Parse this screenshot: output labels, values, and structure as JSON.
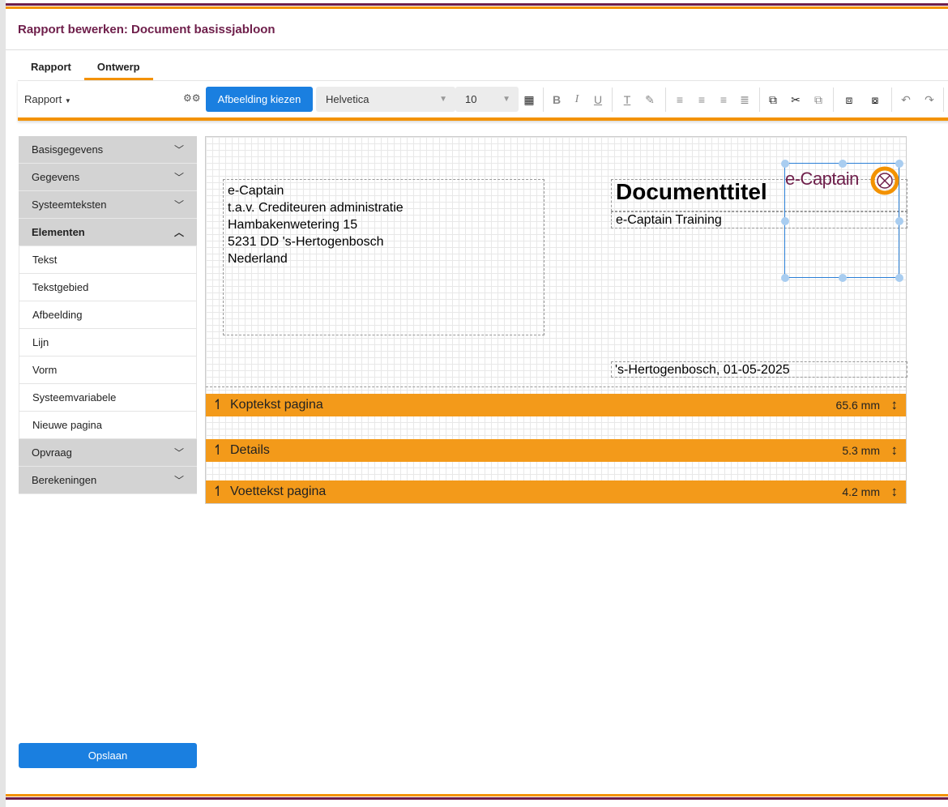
{
  "page": {
    "title": "Rapport bewerken: Document basissjabloon"
  },
  "tabs": [
    {
      "label": "Rapport",
      "active": false
    },
    {
      "label": "Ontwerp",
      "active": true
    }
  ],
  "toolbar": {
    "report_dropdown": "Rapport",
    "choose_image_button": "Afbeelding kiezen",
    "font_family": "Helvetica",
    "font_size": "10",
    "icons": [
      "grid-icon",
      "bold-icon",
      "italic-icon",
      "underline-icon",
      "text-color-icon",
      "highlight-icon",
      "align-left-icon",
      "align-center-icon",
      "align-right-icon",
      "align-justify-icon",
      "copy-icon",
      "cut-icon",
      "paste-icon",
      "bring-front-icon",
      "send-back-icon",
      "undo-icon",
      "redo-icon"
    ]
  },
  "sidebar": {
    "sections": [
      {
        "label": "Basisgegevens",
        "expanded": false
      },
      {
        "label": "Gegevens",
        "expanded": false
      },
      {
        "label": "Systeemteksten",
        "expanded": false
      },
      {
        "label": "Elementen",
        "expanded": true
      },
      {
        "label": "Opvraag",
        "expanded": false
      },
      {
        "label": "Berekeningen",
        "expanded": false
      }
    ],
    "elements": [
      "Tekst",
      "Tekstgebied",
      "Afbeelding",
      "Lijn",
      "Vorm",
      "Systeemvariabele",
      "Nieuwe pagina"
    ],
    "save_button": "Opslaan"
  },
  "canvas": {
    "address_lines": [
      "e-Captain",
      "t.a.v. Crediteuren administratie",
      "Hambakenwetering 15",
      "5231 DD 's-Hertogenbosch",
      "Nederland"
    ],
    "document_title": "Documenttitel",
    "subtitle": "e-Captain Training",
    "logo_text": "e-Captain",
    "date_line": "'s-Hertogenbosch, 01-05-2025"
  },
  "bands": [
    {
      "label": "Koptekst pagina",
      "height": "65.6 mm"
    },
    {
      "label": "Details",
      "height": "5.3 mm"
    },
    {
      "label": "Voettekst pagina",
      "height": "4.2 mm"
    }
  ],
  "colors": {
    "brand": "#6e1e4a",
    "accent": "#f39200",
    "primary_button": "#1a7fe0",
    "band": "#f39a1a",
    "selection": "#2a7fd6"
  }
}
